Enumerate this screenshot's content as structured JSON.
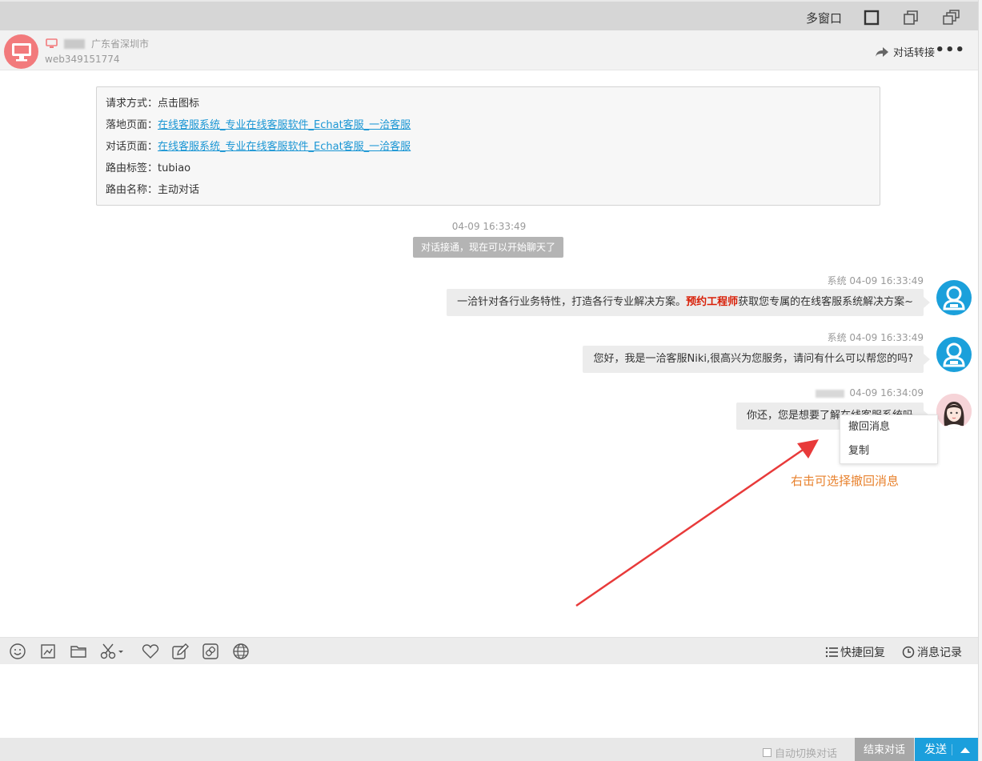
{
  "topbar": {
    "multi_window_label": "多窗口"
  },
  "visitor": {
    "location": "广东省深圳市",
    "id": "web349151774",
    "transfer_label": "对话转接",
    "more_label": "•••"
  },
  "info_card": {
    "rows": [
      {
        "label": "请求方式：",
        "value": "点击图标",
        "link": false
      },
      {
        "label": "落地页面：",
        "value": "在线客服系统_专业在线客服软件_Echat客服_一洽客服",
        "link": true
      },
      {
        "label": "对话页面：",
        "value": "在线客服系统_专业在线客服软件_Echat客服_一洽客服",
        "link": true
      },
      {
        "label": "路由标签：",
        "value": "tubiao",
        "link": false
      },
      {
        "label": "路由名称：",
        "value": "主动对话",
        "link": false
      }
    ]
  },
  "system": {
    "time": "04-09 16:33:49",
    "notice": "对话接通，现在可以开始聊天了"
  },
  "messages": [
    {
      "sender": "系统",
      "time": "04-09 16:33:49",
      "text_before": "一洽针对各行业务特性，打造各行专业解决方案。",
      "highlight": "预约工程师",
      "text_after": "获取您专属的在线客服系统解决方案~"
    },
    {
      "sender": "系统",
      "time": "04-09 16:33:49",
      "text": "您好，我是一洽客服Niki,很高兴为您服务，请问有什么可以帮您的吗?"
    },
    {
      "time": "04-09 16:34:09",
      "text": "你还，您是想要了解在线客服系统吗"
    }
  ],
  "context_menu": {
    "items": [
      "撤回消息",
      "复制"
    ]
  },
  "annotation": "右击可选择撤回消息",
  "toolbar": {
    "icons": [
      "smile-icon",
      "screenshot-icon",
      "folder-icon",
      "scissors-icon",
      "heart-icon",
      "edit-icon",
      "link-icon",
      "globe-icon"
    ],
    "quick_reply_label": "快捷回复",
    "history_label": "消息记录"
  },
  "bottom": {
    "auto_switch_label": "自动切换对话",
    "end_label": "结束对话",
    "send_label": "发送"
  },
  "colors": {
    "accent": "#1b9fdc",
    "visitor_avatar": "#f27a7c",
    "highlight": "#d81e06",
    "annotation": "#e8822e",
    "arrow": "#e83a3a"
  }
}
